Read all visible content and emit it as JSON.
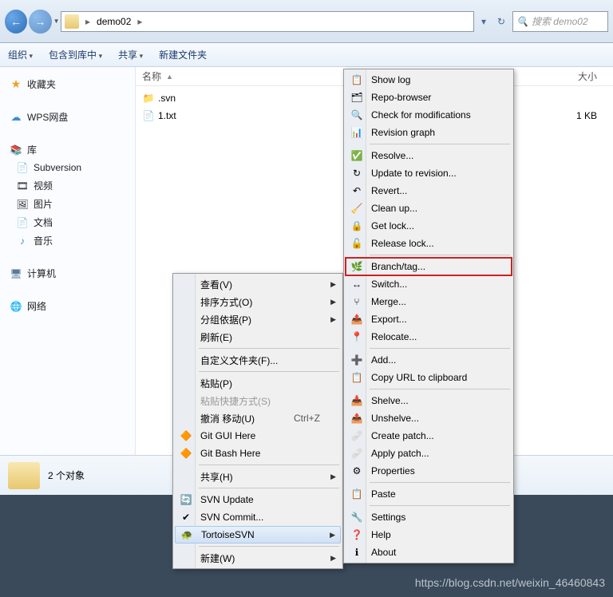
{
  "address": {
    "folder": "demo02",
    "sep1": "▸",
    "sep2": "▸"
  },
  "search": {
    "placeholder": "搜索 demo02"
  },
  "toolbar": {
    "organize": "组织",
    "include": "包含到库中",
    "share": "共享",
    "newfolder": "新建文件夹"
  },
  "sidebar": {
    "favorites": "收藏夹",
    "wps": "WPS网盘",
    "library": "库",
    "libs": [
      "Subversion",
      "视频",
      "图片",
      "文档",
      "音乐"
    ],
    "computer": "计算机",
    "network": "网络"
  },
  "columns": {
    "name": "名称",
    "size": "大小"
  },
  "files": [
    {
      "name": ".svn",
      "size": ""
    },
    {
      "name": "1.txt",
      "size": "1 KB"
    }
  ],
  "status": {
    "text": "2 个对象"
  },
  "ctx_left": [
    {
      "label": "查看(V)",
      "arrow": true
    },
    {
      "label": "排序方式(O)",
      "arrow": true
    },
    {
      "label": "分组依据(P)",
      "arrow": true
    },
    {
      "label": "刷新(E)"
    },
    {
      "sep": true
    },
    {
      "label": "自定义文件夹(F)..."
    },
    {
      "sep": true
    },
    {
      "label": "粘贴(P)"
    },
    {
      "label": "粘贴快捷方式(S)",
      "disabled": true
    },
    {
      "label": "撤消 移动(U)",
      "shortcut": "Ctrl+Z"
    },
    {
      "label": "Git GUI Here",
      "icon": "git"
    },
    {
      "label": "Git Bash Here",
      "icon": "git"
    },
    {
      "sep": true
    },
    {
      "label": "共享(H)",
      "arrow": true
    },
    {
      "sep": true
    },
    {
      "label": "SVN Update",
      "icon": "svn-up"
    },
    {
      "label": "SVN Commit...",
      "icon": "svn-commit"
    },
    {
      "label": "TortoiseSVN",
      "icon": "tortoise",
      "arrow": true,
      "hl": true
    },
    {
      "sep": true
    },
    {
      "label": "新建(W)",
      "arrow": true
    }
  ],
  "ctx_right": [
    {
      "label": "Show log",
      "icon": "log"
    },
    {
      "label": "Repo-browser",
      "icon": "repo"
    },
    {
      "label": "Check for modifications",
      "icon": "check"
    },
    {
      "label": "Revision graph",
      "icon": "graph"
    },
    {
      "sep": true
    },
    {
      "label": "Resolve...",
      "icon": "resolve"
    },
    {
      "label": "Update to revision...",
      "icon": "update"
    },
    {
      "label": "Revert...",
      "icon": "revert"
    },
    {
      "label": "Clean up...",
      "icon": "clean"
    },
    {
      "label": "Get lock...",
      "icon": "lock"
    },
    {
      "label": "Release lock...",
      "icon": "unlock"
    },
    {
      "sep": true
    },
    {
      "label": "Branch/tag...",
      "icon": "branch",
      "boxed": true
    },
    {
      "label": "Switch...",
      "icon": "switch"
    },
    {
      "label": "Merge...",
      "icon": "merge"
    },
    {
      "label": "Export...",
      "icon": "export"
    },
    {
      "label": "Relocate...",
      "icon": "relocate"
    },
    {
      "sep": true
    },
    {
      "label": "Add...",
      "icon": "add"
    },
    {
      "label": "Copy URL to clipboard",
      "icon": "copy"
    },
    {
      "sep": true
    },
    {
      "label": "Shelve...",
      "icon": "shelve"
    },
    {
      "label": "Unshelve...",
      "icon": "unshelve"
    },
    {
      "label": "Create patch...",
      "icon": "patch"
    },
    {
      "label": "Apply patch...",
      "icon": "apply"
    },
    {
      "label": "Properties",
      "icon": "props"
    },
    {
      "sep": true
    },
    {
      "label": "Paste",
      "icon": "paste"
    },
    {
      "sep": true
    },
    {
      "label": "Settings",
      "icon": "settings"
    },
    {
      "label": "Help",
      "icon": "help"
    },
    {
      "label": "About",
      "icon": "about"
    }
  ],
  "watermark": "https://blog.csdn.net/weixin_46460843"
}
